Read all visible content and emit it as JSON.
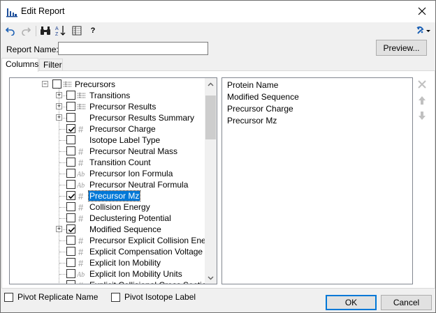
{
  "window": {
    "title": "Edit Report",
    "close": "✕"
  },
  "toolbar": {
    "undo": "undo-icon",
    "redo": "redo-icon",
    "find": "binoculars-icon",
    "sort": "sort-az-icon",
    "columns": "columns-icon",
    "help": "?",
    "dropdown": "add-dropdown-icon"
  },
  "report_name": {
    "label": "Report Name:",
    "value": ""
  },
  "preview_button": "Preview...",
  "tabs": [
    {
      "label": "Columns"
    },
    {
      "label": "Filter"
    }
  ],
  "tree": {
    "rows": [
      {
        "label": "Precursors",
        "icon": "table",
        "checked": false,
        "expander": "minus",
        "level": 0
      },
      {
        "label": "Transitions",
        "icon": "table",
        "checked": false,
        "expander": "plus",
        "level": 1
      },
      {
        "label": "Precursor Results",
        "icon": "table",
        "checked": false,
        "expander": "plus",
        "level": 1
      },
      {
        "label": "Precursor Results Summary",
        "icon": "none",
        "checked": false,
        "expander": "plus",
        "level": 1
      },
      {
        "label": "Precursor Charge",
        "icon": "hash",
        "checked": true,
        "expander": "none",
        "level": 1
      },
      {
        "label": "Isotope Label Type",
        "icon": "none",
        "checked": false,
        "expander": "none",
        "level": 1
      },
      {
        "label": "Precursor Neutral Mass",
        "icon": "hash",
        "checked": false,
        "expander": "none",
        "level": 1
      },
      {
        "label": "Transition Count",
        "icon": "hash",
        "checked": false,
        "expander": "none",
        "level": 1
      },
      {
        "label": "Precursor Ion Formula",
        "icon": "ab",
        "checked": false,
        "expander": "none",
        "level": 1
      },
      {
        "label": "Precursor Neutral Formula",
        "icon": "ab",
        "checked": false,
        "expander": "none",
        "level": 1
      },
      {
        "label": "Precursor Mz",
        "icon": "hash",
        "checked": true,
        "expander": "none",
        "level": 1,
        "selected": true
      },
      {
        "label": "Collision Energy",
        "icon": "hash",
        "checked": false,
        "expander": "none",
        "level": 1
      },
      {
        "label": "Declustering Potential",
        "icon": "hash",
        "checked": false,
        "expander": "none",
        "level": 1
      },
      {
        "label": "Modified Sequence",
        "icon": "none",
        "checked": true,
        "expander": "plus",
        "level": 1
      },
      {
        "label": "Precursor Explicit Collision Energy",
        "icon": "hash",
        "checked": false,
        "expander": "none",
        "level": 1
      },
      {
        "label": "Explicit Compensation Voltage",
        "icon": "hash",
        "checked": false,
        "expander": "none",
        "level": 1
      },
      {
        "label": "Explicit Ion Mobility",
        "icon": "hash",
        "checked": false,
        "expander": "none",
        "level": 1
      },
      {
        "label": "Explicit Ion Mobility Units",
        "icon": "ab",
        "checked": false,
        "expander": "none",
        "level": 1
      },
      {
        "label": "Explicit Collisional Cross Section",
        "icon": "hash",
        "checked": false,
        "expander": "none",
        "level": 1
      }
    ]
  },
  "selected_columns": [
    "Protein Name",
    "Modified Sequence",
    "Precursor Charge",
    "Precursor Mz"
  ],
  "side_buttons": {
    "remove": "remove-icon",
    "up": "move-up-icon",
    "down": "move-down-icon"
  },
  "pivot_replicate": {
    "label": "Pivot Replicate Name",
    "checked": false
  },
  "pivot_isotope": {
    "label": "Pivot Isotope Label",
    "checked": false
  },
  "ok_button": "OK",
  "cancel_button": "Cancel",
  "colors": {
    "accent": "#0078d7",
    "selection": "#0078d7"
  }
}
